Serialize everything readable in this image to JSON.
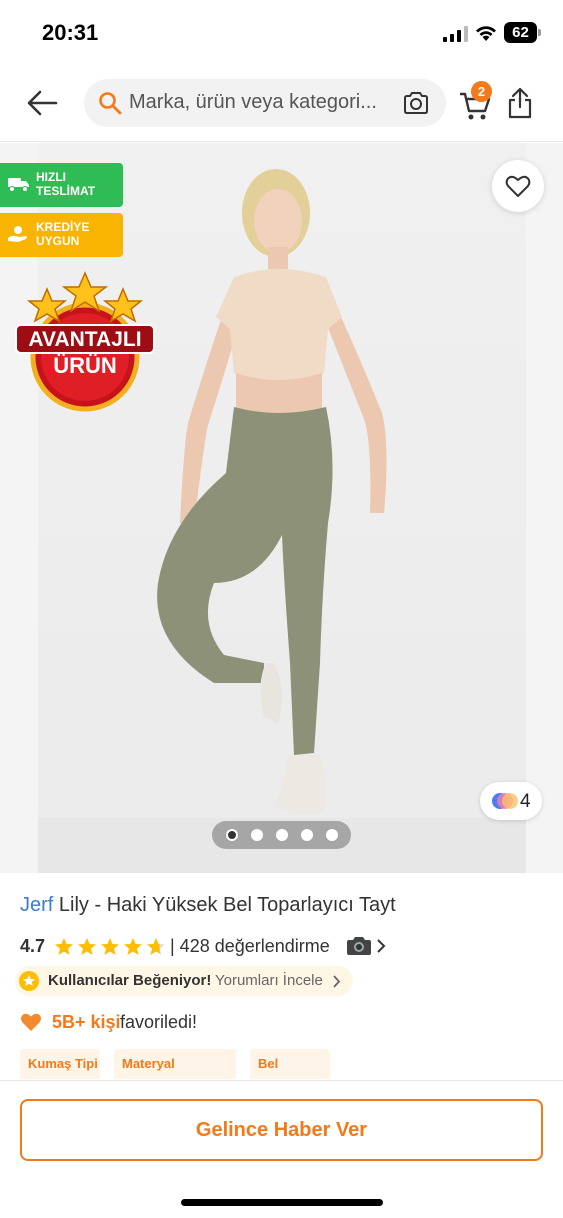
{
  "status_bar": {
    "time": "20:31",
    "battery": "62"
  },
  "nav": {
    "search_placeholder": "Marka, ürün veya kategori...",
    "cart_count": "2"
  },
  "gallery": {
    "tags": [
      {
        "line1": "HIZLI",
        "line2": "TESLİMAT",
        "color": "#2fbc55"
      },
      {
        "line1": "KREDİYE",
        "line2": "UYGUN",
        "color": "#f8b400"
      }
    ],
    "advantage_badge": {
      "line1": "AVANTAJLI",
      "line2": "ÜRÜN"
    },
    "color_count": "4",
    "image_count": 5,
    "active_image": 1
  },
  "product": {
    "brand": "Jerf",
    "name": "Lily - Haki Yüksek Bel Toparlayıcı Tayt",
    "rating": "4.7",
    "rating_stars": 4.7,
    "rating_count": "| 428 değerlendirme"
  },
  "liked_banner": {
    "title": "Kullanıcılar Beğeniyor!",
    "link": "Yorumları İncele"
  },
  "favorites": {
    "count": "5B+ kişi",
    "text": "favoriledi!"
  },
  "attributes": [
    {
      "label": "Kumaş Tipi"
    },
    {
      "label": "Materyal"
    },
    {
      "label": "Bel"
    }
  ],
  "actions": {
    "notify_label": "Gelince Haber Ver"
  },
  "colors": {
    "accent": "#f27a1a",
    "brand_link": "#3b7bd6",
    "star": "#ffbd00"
  }
}
